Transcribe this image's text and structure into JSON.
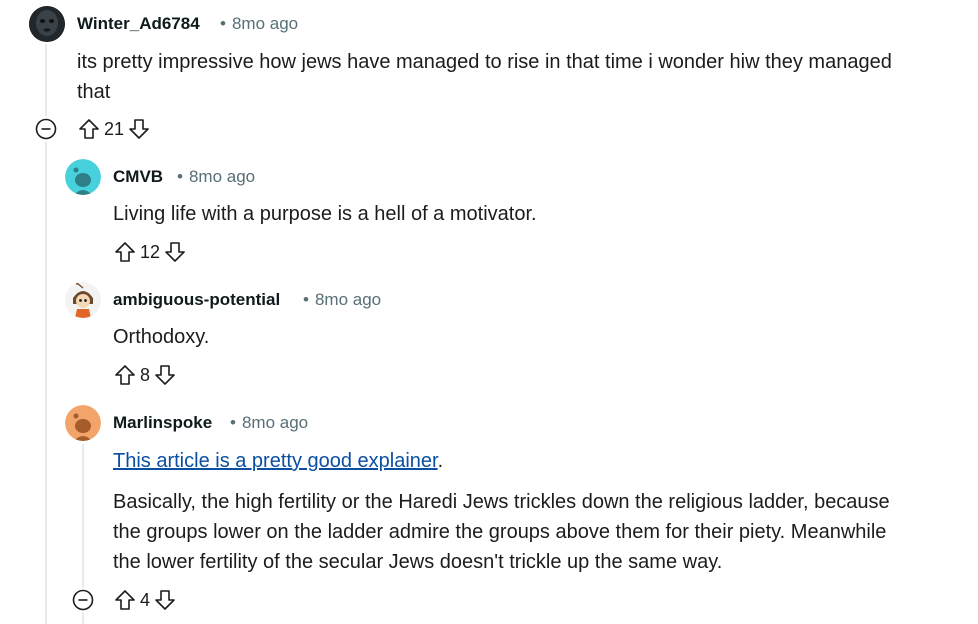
{
  "comments": [
    {
      "author": "Winter_Ad6784",
      "dot": "•",
      "time": "8mo ago",
      "body_line1": "its pretty impressive how jews have managed to rise in that time i wonder hiw they managed",
      "body_line2": "that",
      "score": "21",
      "avatar_icon": "dark-face-avatar"
    },
    {
      "author": "CMVB",
      "dot": "•",
      "time": "8mo ago",
      "body": "Living life with a purpose is a hell of a motivator.",
      "score": "12",
      "avatar_icon": "teal-snoo-avatar"
    },
    {
      "author": "ambiguous-potential",
      "dot": "•",
      "time": "8mo ago",
      "body": "Orthodoxy.",
      "score": "8",
      "avatar_icon": "cartoon-character-avatar"
    },
    {
      "author": "Marlinspoke",
      "dot": "•",
      "time": "8mo ago",
      "link_text": "This article is a pretty good explainer",
      "link_suffix": ".",
      "para_line1": "Basically, the high fertility or the Haredi Jews trickles down the religious ladder, because",
      "para_line2": "the groups lower on the ladder admire the groups above them for their piety. Meanwhile",
      "para_line3": "the lower fertility of the secular Jews doesn't trickle up the same way.",
      "score": "4",
      "avatar_icon": "orange-snoo-avatar"
    }
  ],
  "colors": {
    "thread_line": "#e5ebee",
    "link": "#0b4fa3",
    "meta": "#576f76",
    "teal_avatar": "#46d1dc",
    "orange_avatar": "#f3a46b"
  }
}
